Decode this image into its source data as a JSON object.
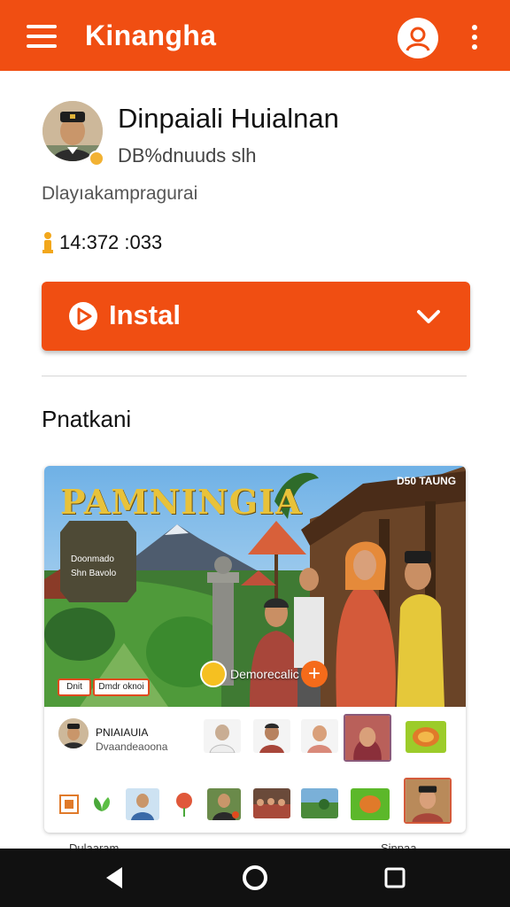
{
  "app_bar": {
    "title": "Kinangha",
    "menu_icon": "hamburger-menu-icon",
    "profile_icon": "person-outline-icon",
    "overflow_icon": "more-vert-icon",
    "color": "#f04e12"
  },
  "profile": {
    "name": "Dinpaiali Huialnan",
    "subtitle": "DB%dnuuds slh",
    "description": "Dlayıakampragurai",
    "stat_icon": "person-stat-icon",
    "stat_value": "14:372 :033"
  },
  "install": {
    "label": "Instal",
    "icon": "play-circle-icon",
    "chevron": "chevron-down-icon"
  },
  "section": {
    "title": "Pnatkani"
  },
  "card": {
    "hero_title": "PAMNINGIA",
    "hero_corner": "D50 TAUNG",
    "panel_line1": "Doonmado",
    "panel_line2": "Shn Bavolo",
    "chip_a": "Dnit",
    "chip_b": "Dmdr oknoi",
    "tag_label": "Demorecalic",
    "creator_name": "PNIAIAUIA",
    "creator_sub": "Dvaandeaoona"
  },
  "peek": {
    "left": "Dulaaram",
    "right": "Sinpaa"
  },
  "system_nav": {
    "back_icon": "back-triangle-icon",
    "home_icon": "home-circle-icon",
    "recents_icon": "recents-square-icon"
  }
}
